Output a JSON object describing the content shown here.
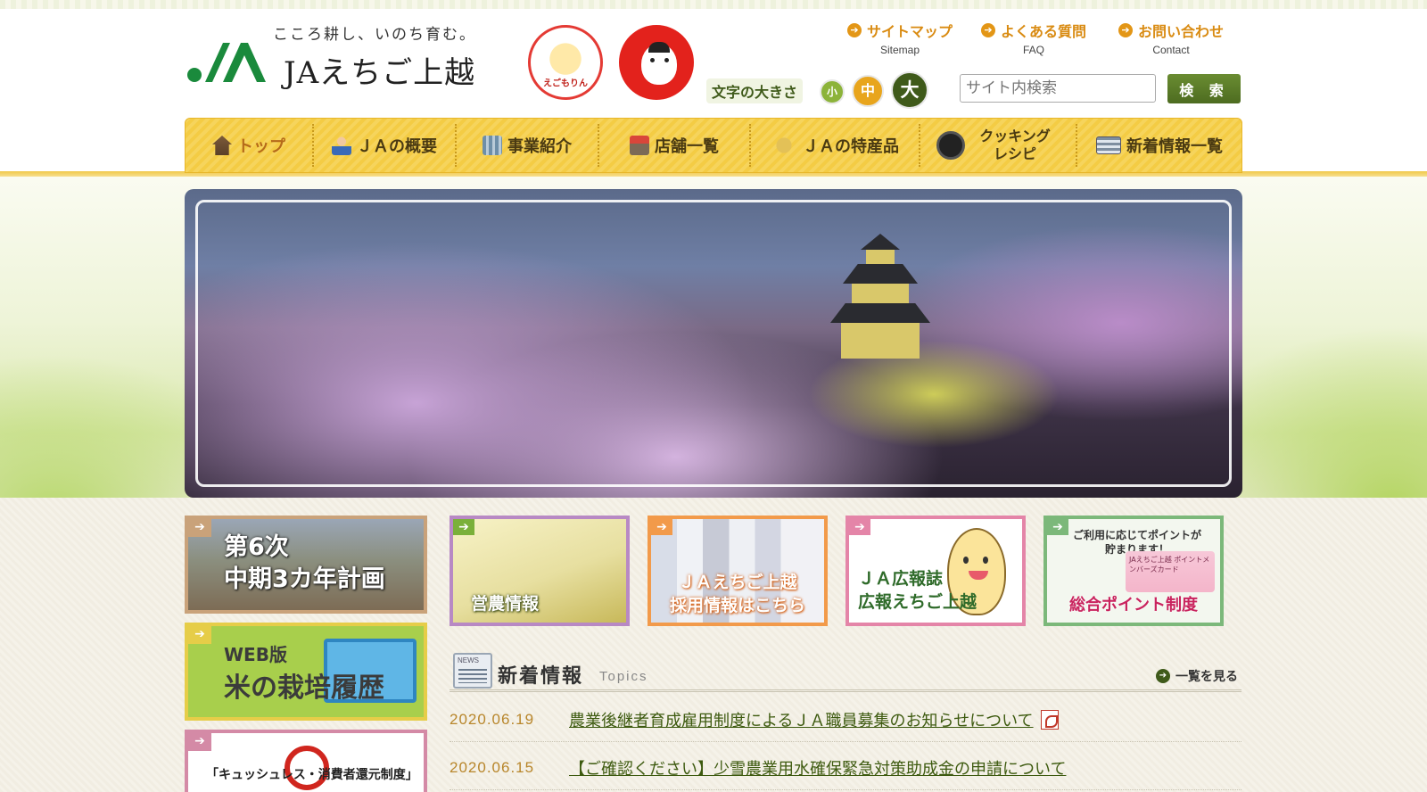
{
  "header": {
    "tagline": "こころ耕し、いのち育む。",
    "site_name": "JAえちご上越",
    "mascot1_label": "えごもりん",
    "util_links": [
      {
        "jp": "サイトマップ",
        "en": "Sitemap"
      },
      {
        "jp": "よくある質問",
        "en": "FAQ"
      },
      {
        "jp": "お問い合わせ",
        "en": "Contact"
      }
    ],
    "font_size": {
      "label": "文字の大きさ",
      "small": "小",
      "medium": "中",
      "large": "大"
    },
    "search": {
      "placeholder": "サイト内検索",
      "button": "検 索"
    }
  },
  "nav": {
    "items": [
      {
        "label": "トップ",
        "icon": "home-icon"
      },
      {
        "label": "ＪＡの概要",
        "icon": "person-icon"
      },
      {
        "label": "事業紹介",
        "icon": "building-icon"
      },
      {
        "label": "店舗一覧",
        "icon": "shop-icon"
      },
      {
        "label": "ＪＡの特産品",
        "icon": "rice-icon"
      },
      {
        "label": "クッキング レシピ",
        "icon": "frying-pan-icon"
      },
      {
        "label": "新着情報一覧",
        "icon": "news-icon"
      }
    ]
  },
  "side_banners": {
    "plan": {
      "line1": "第6次",
      "line2": "中期3カ年計画"
    },
    "rice": {
      "line1": "WEB版",
      "line2": "米の栽培履歴"
    },
    "cashless": {
      "label": "「キュッシュレス・消費者還元制度」"
    }
  },
  "top_banners": {
    "farming": {
      "label": "営農情報"
    },
    "recruit": {
      "line1": "ＪＡえちご上越",
      "line2": "採用情報はこちら"
    },
    "pr": {
      "line1": "ＪＡ広報誌",
      "line2": "広報えちご上越"
    },
    "points": {
      "line1": "ご利用に応じてポイントが",
      "line2": "貯まります！",
      "card": "JAえちご上越 ポイントメンバーズカード",
      "label": "総合ポイント制度"
    }
  },
  "topics": {
    "title": "新着情報",
    "subtitle": "Topics",
    "view_all": "一覧を見る",
    "items": [
      {
        "date": "2020.06.19",
        "text": "農業後継者育成雇用制度によるＪＡ職員募集のお知らせについて"
      },
      {
        "date": "2020.06.15",
        "text": "【ご確認ください】少雪農業用水確保緊急対策助成金の申請について"
      }
    ]
  }
}
